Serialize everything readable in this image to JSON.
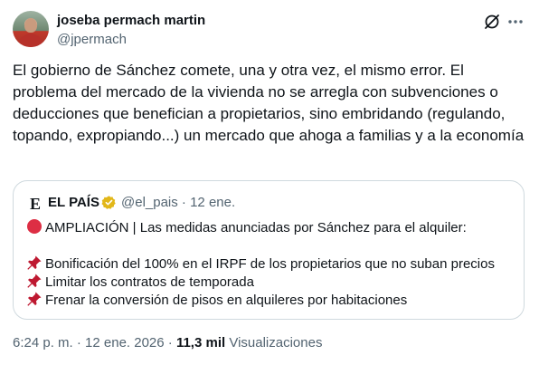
{
  "author": {
    "name": "joseba permach martin",
    "handle": "@jpermach"
  },
  "tweet": {
    "text": "El gobierno de Sánchez comete, una y otra vez, el mismo error. El problema del mercado de la vivienda no se arregla con subvenciones o deducciones que benefician a propietarios, sino embridando (regulando, topando, expropiando...) un mercado que ahoga a familias y a la economía"
  },
  "quote": {
    "logo": "E",
    "name": "EL PAÍS",
    "handle_date": "@el_pais · 12 ene.",
    "headline": "AMPLIACIÓN | Las medidas anunciadas por Sánchez para el alquiler:",
    "items": [
      "Bonificación del 100% en el IRPF de los propietarios que no suban precios",
      "Limitar los contratos de temporada",
      "Frenar la conversión de pisos en alquileres por habitaciones"
    ],
    "icons": [
      "red-circle-icon",
      "pushpin-icon",
      "verified-gold-badge-icon"
    ]
  },
  "meta": {
    "time": "6:24 p. m. · 12 ene. 2026 · ",
    "views": "11,3 mil",
    "views_label": " Visualizaciones"
  },
  "colors": {
    "primary_text": "#0f1419",
    "secondary_text": "#536471",
    "border": "#cfd9de",
    "badge_gold": "#e2b719",
    "red_circle": "#dd2e44"
  }
}
